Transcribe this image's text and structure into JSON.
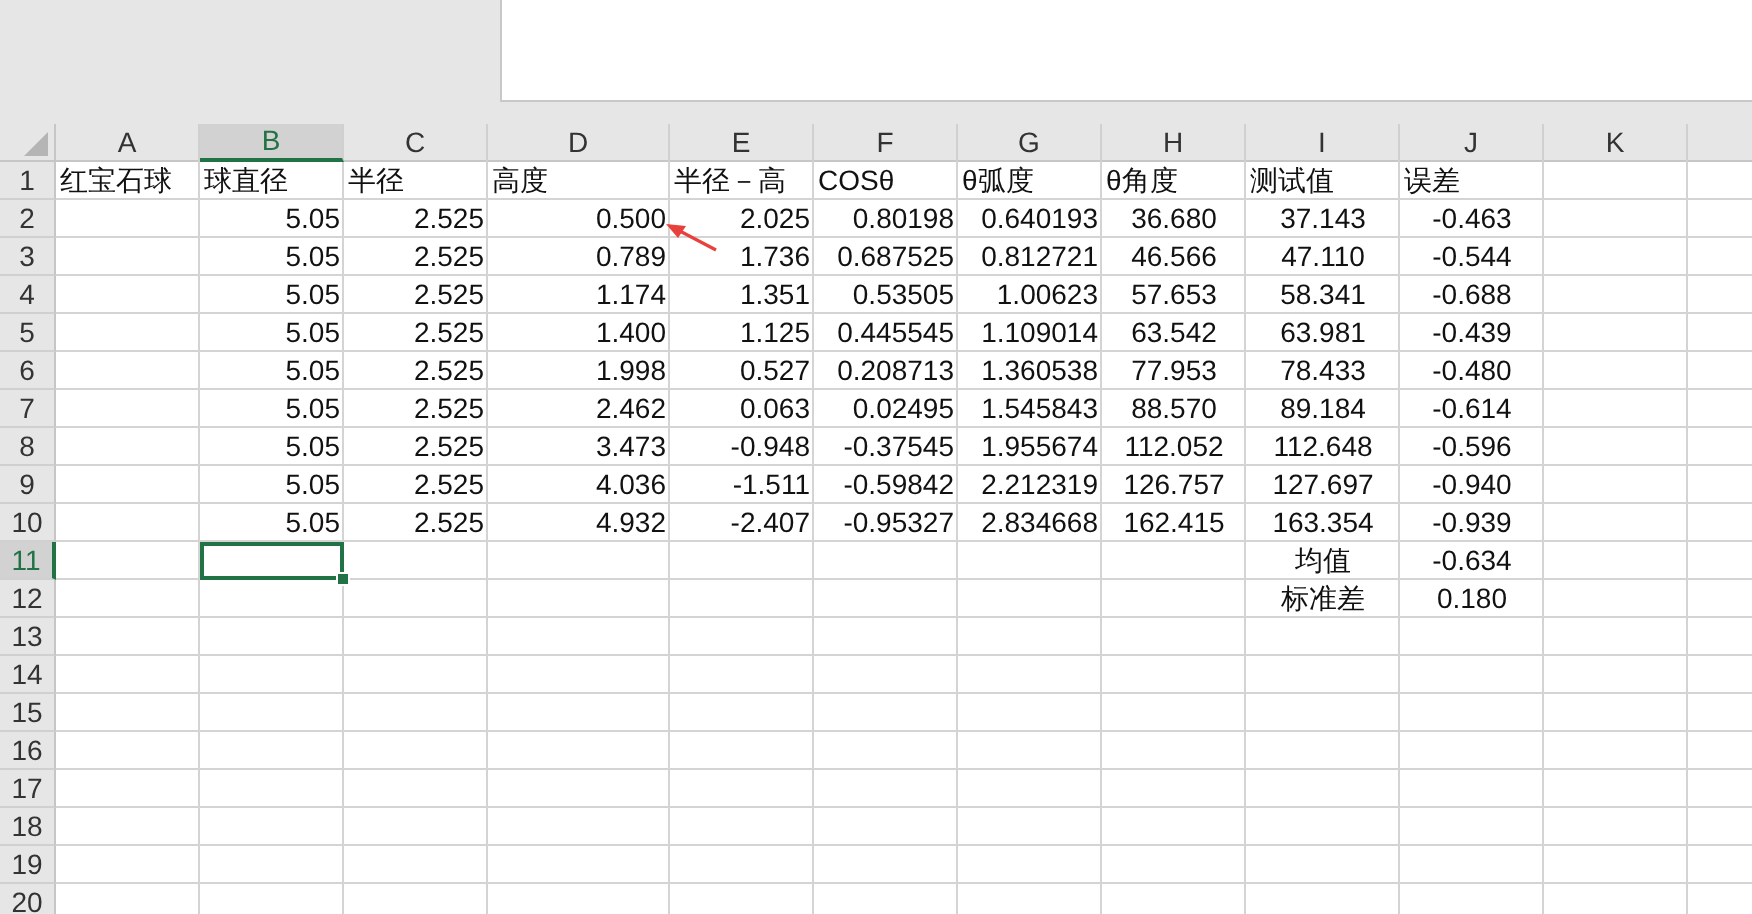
{
  "columns": [
    {
      "label": "A",
      "selected": false
    },
    {
      "label": "B",
      "selected": true
    },
    {
      "label": "C",
      "selected": false
    },
    {
      "label": "D",
      "selected": false
    },
    {
      "label": "E",
      "selected": false
    },
    {
      "label": "F",
      "selected": false
    },
    {
      "label": "G",
      "selected": false
    },
    {
      "label": "H",
      "selected": false
    },
    {
      "label": "I",
      "selected": false
    },
    {
      "label": "J",
      "selected": false
    },
    {
      "label": "K",
      "selected": false
    }
  ],
  "rows": [
    {
      "number": "1",
      "selected": false,
      "cells": [
        {
          "text": "红宝石球",
          "kind": "text",
          "selected": false
        },
        {
          "text": "球直径",
          "kind": "text",
          "selected": false
        },
        {
          "text": "半径",
          "kind": "text",
          "selected": false
        },
        {
          "text": "高度",
          "kind": "text",
          "selected": false
        },
        {
          "text": "半径－高",
          "kind": "text",
          "selected": false
        },
        {
          "text": "COSθ",
          "kind": "text",
          "selected": false
        },
        {
          "text": "θ弧度",
          "kind": "text",
          "selected": false
        },
        {
          "text": "θ角度",
          "kind": "text",
          "selected": false
        },
        {
          "text": "测试值",
          "kind": "text",
          "selected": false
        },
        {
          "text": "误差",
          "kind": "text",
          "selected": false
        }
      ]
    },
    {
      "number": "2",
      "selected": false,
      "cells": [
        null,
        {
          "text": "5.05",
          "kind": "number",
          "selected": false
        },
        {
          "text": "2.525",
          "kind": "number",
          "selected": false
        },
        {
          "text": "0.500",
          "kind": "number",
          "selected": false
        },
        {
          "text": "2.025",
          "kind": "number",
          "selected": false
        },
        {
          "text": "0.80198",
          "kind": "number",
          "selected": false
        },
        {
          "text": "0.640193",
          "kind": "number",
          "selected": false
        },
        {
          "text": "36.680",
          "kind": "center",
          "selected": false
        },
        {
          "text": "37.143",
          "kind": "center",
          "selected": false
        },
        {
          "text": "-0.463",
          "kind": "center",
          "selected": false
        }
      ]
    },
    {
      "number": "3",
      "selected": false,
      "cells": [
        null,
        {
          "text": "5.05",
          "kind": "number",
          "selected": false
        },
        {
          "text": "2.525",
          "kind": "number",
          "selected": false
        },
        {
          "text": "0.789",
          "kind": "number",
          "selected": false
        },
        {
          "text": "1.736",
          "kind": "number",
          "selected": false
        },
        {
          "text": "0.687525",
          "kind": "number",
          "selected": false
        },
        {
          "text": "0.812721",
          "kind": "number",
          "selected": false
        },
        {
          "text": "46.566",
          "kind": "center",
          "selected": false
        },
        {
          "text": "47.110",
          "kind": "center",
          "selected": false
        },
        {
          "text": "-0.544",
          "kind": "center",
          "selected": false
        }
      ]
    },
    {
      "number": "4",
      "selected": false,
      "cells": [
        null,
        {
          "text": "5.05",
          "kind": "number",
          "selected": false
        },
        {
          "text": "2.525",
          "kind": "number",
          "selected": false
        },
        {
          "text": "1.174",
          "kind": "number",
          "selected": false
        },
        {
          "text": "1.351",
          "kind": "number",
          "selected": false
        },
        {
          "text": "0.53505",
          "kind": "number",
          "selected": false
        },
        {
          "text": "1.00623",
          "kind": "number",
          "selected": false
        },
        {
          "text": "57.653",
          "kind": "center",
          "selected": false
        },
        {
          "text": "58.341",
          "kind": "center",
          "selected": false
        },
        {
          "text": "-0.688",
          "kind": "center",
          "selected": false
        }
      ]
    },
    {
      "number": "5",
      "selected": false,
      "cells": [
        null,
        {
          "text": "5.05",
          "kind": "number",
          "selected": false
        },
        {
          "text": "2.525",
          "kind": "number",
          "selected": false
        },
        {
          "text": "1.400",
          "kind": "number",
          "selected": false
        },
        {
          "text": "1.125",
          "kind": "number",
          "selected": false
        },
        {
          "text": "0.445545",
          "kind": "number",
          "selected": false
        },
        {
          "text": "1.109014",
          "kind": "number",
          "selected": false
        },
        {
          "text": "63.542",
          "kind": "center",
          "selected": false
        },
        {
          "text": "63.981",
          "kind": "center",
          "selected": false
        },
        {
          "text": "-0.439",
          "kind": "center",
          "selected": false
        }
      ]
    },
    {
      "number": "6",
      "selected": false,
      "cells": [
        null,
        {
          "text": "5.05",
          "kind": "number",
          "selected": false
        },
        {
          "text": "2.525",
          "kind": "number",
          "selected": false
        },
        {
          "text": "1.998",
          "kind": "number",
          "selected": false
        },
        {
          "text": "0.527",
          "kind": "number",
          "selected": false
        },
        {
          "text": "0.208713",
          "kind": "number",
          "selected": false
        },
        {
          "text": "1.360538",
          "kind": "number",
          "selected": false
        },
        {
          "text": "77.953",
          "kind": "center",
          "selected": false
        },
        {
          "text": "78.433",
          "kind": "center",
          "selected": false
        },
        {
          "text": "-0.480",
          "kind": "center",
          "selected": false
        }
      ]
    },
    {
      "number": "7",
      "selected": false,
      "cells": [
        null,
        {
          "text": "5.05",
          "kind": "number",
          "selected": false
        },
        {
          "text": "2.525",
          "kind": "number",
          "selected": false
        },
        {
          "text": "2.462",
          "kind": "number",
          "selected": false
        },
        {
          "text": "0.063",
          "kind": "number",
          "selected": false
        },
        {
          "text": "0.02495",
          "kind": "number",
          "selected": false
        },
        {
          "text": "1.545843",
          "kind": "number",
          "selected": false
        },
        {
          "text": "88.570",
          "kind": "center",
          "selected": false
        },
        {
          "text": "89.184",
          "kind": "center",
          "selected": false
        },
        {
          "text": "-0.614",
          "kind": "center",
          "selected": false
        }
      ]
    },
    {
      "number": "8",
      "selected": false,
      "cells": [
        null,
        {
          "text": "5.05",
          "kind": "number",
          "selected": false
        },
        {
          "text": "2.525",
          "kind": "number",
          "selected": false
        },
        {
          "text": "3.473",
          "kind": "number",
          "selected": false
        },
        {
          "text": "-0.948",
          "kind": "number",
          "selected": false
        },
        {
          "text": "-0.37545",
          "kind": "number",
          "selected": false
        },
        {
          "text": "1.955674",
          "kind": "number",
          "selected": false
        },
        {
          "text": "112.052",
          "kind": "center",
          "selected": false
        },
        {
          "text": "112.648",
          "kind": "center",
          "selected": false
        },
        {
          "text": "-0.596",
          "kind": "center",
          "selected": false
        }
      ]
    },
    {
      "number": "9",
      "selected": false,
      "cells": [
        null,
        {
          "text": "5.05",
          "kind": "number",
          "selected": false
        },
        {
          "text": "2.525",
          "kind": "number",
          "selected": false
        },
        {
          "text": "4.036",
          "kind": "number",
          "selected": false
        },
        {
          "text": "-1.511",
          "kind": "number",
          "selected": false
        },
        {
          "text": "-0.59842",
          "kind": "number",
          "selected": false
        },
        {
          "text": "2.212319",
          "kind": "number",
          "selected": false
        },
        {
          "text": "126.757",
          "kind": "center",
          "selected": false
        },
        {
          "text": "127.697",
          "kind": "center",
          "selected": false
        },
        {
          "text": "-0.940",
          "kind": "center",
          "selected": false
        }
      ]
    },
    {
      "number": "10",
      "selected": false,
      "cells": [
        null,
        {
          "text": "5.05",
          "kind": "number",
          "selected": false
        },
        {
          "text": "2.525",
          "kind": "number",
          "selected": false
        },
        {
          "text": "4.932",
          "kind": "number",
          "selected": false
        },
        {
          "text": "-2.407",
          "kind": "number",
          "selected": false
        },
        {
          "text": "-0.95327",
          "kind": "number",
          "selected": false
        },
        {
          "text": "2.834668",
          "kind": "number",
          "selected": false
        },
        {
          "text": "162.415",
          "kind": "center",
          "selected": false
        },
        {
          "text": "163.354",
          "kind": "center",
          "selected": false
        },
        {
          "text": "-0.939",
          "kind": "center",
          "selected": false
        }
      ]
    },
    {
      "number": "11",
      "selected": true,
      "cells": [
        null,
        {
          "selected": true
        },
        null,
        null,
        null,
        null,
        null,
        null,
        {
          "text": "均值",
          "kind": "center",
          "selected": false
        },
        {
          "text": "-0.634",
          "kind": "center",
          "selected": false
        }
      ]
    },
    {
      "number": "12",
      "selected": false,
      "cells": [
        null,
        null,
        null,
        null,
        null,
        null,
        null,
        null,
        {
          "text": "标准差",
          "kind": "center",
          "selected": false
        },
        {
          "text": "0.180",
          "kind": "center",
          "selected": false
        }
      ]
    },
    {
      "number": "13",
      "selected": false
    },
    {
      "number": "14",
      "selected": false
    },
    {
      "number": "15",
      "selected": false
    },
    {
      "number": "16",
      "selected": false
    },
    {
      "number": "17",
      "selected": false
    },
    {
      "number": "18",
      "selected": false
    },
    {
      "number": "19",
      "selected": false
    },
    {
      "number": "20",
      "selected": false
    }
  ]
}
